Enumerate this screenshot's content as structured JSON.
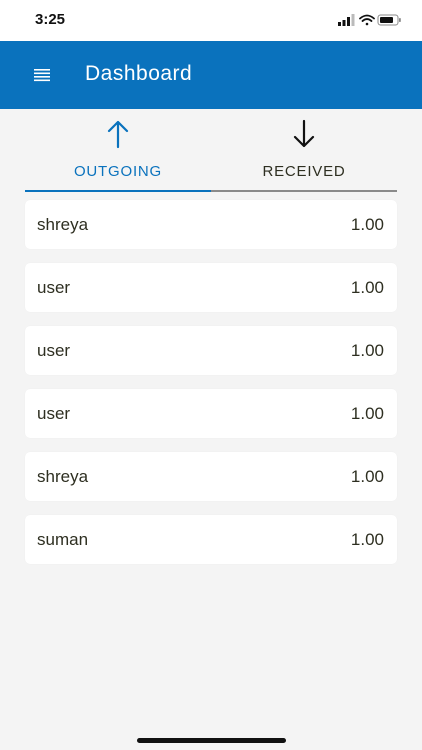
{
  "status_bar": {
    "time": "3:25",
    "icons": [
      "signal-icon",
      "wifi-icon",
      "battery-icon"
    ]
  },
  "app_bar": {
    "title": "Dashboard",
    "menu_icon": "hamburger-menu-icon",
    "background": "#0a72bd"
  },
  "tabs": [
    {
      "label": "OUTGOING",
      "icon": "arrow-up-icon",
      "selected": true,
      "color": "#0a72bd"
    },
    {
      "label": "RECEIVED",
      "icon": "arrow-down-icon",
      "selected": false,
      "color": "#2e2f21"
    }
  ],
  "transactions": [
    {
      "name": "shreya",
      "amount": "1.00"
    },
    {
      "name": "user",
      "amount": "1.00"
    },
    {
      "name": "user",
      "amount": "1.00"
    },
    {
      "name": "user",
      "amount": "1.00"
    },
    {
      "name": "shreya",
      "amount": "1.00"
    },
    {
      "name": "suman",
      "amount": "1.00"
    }
  ]
}
